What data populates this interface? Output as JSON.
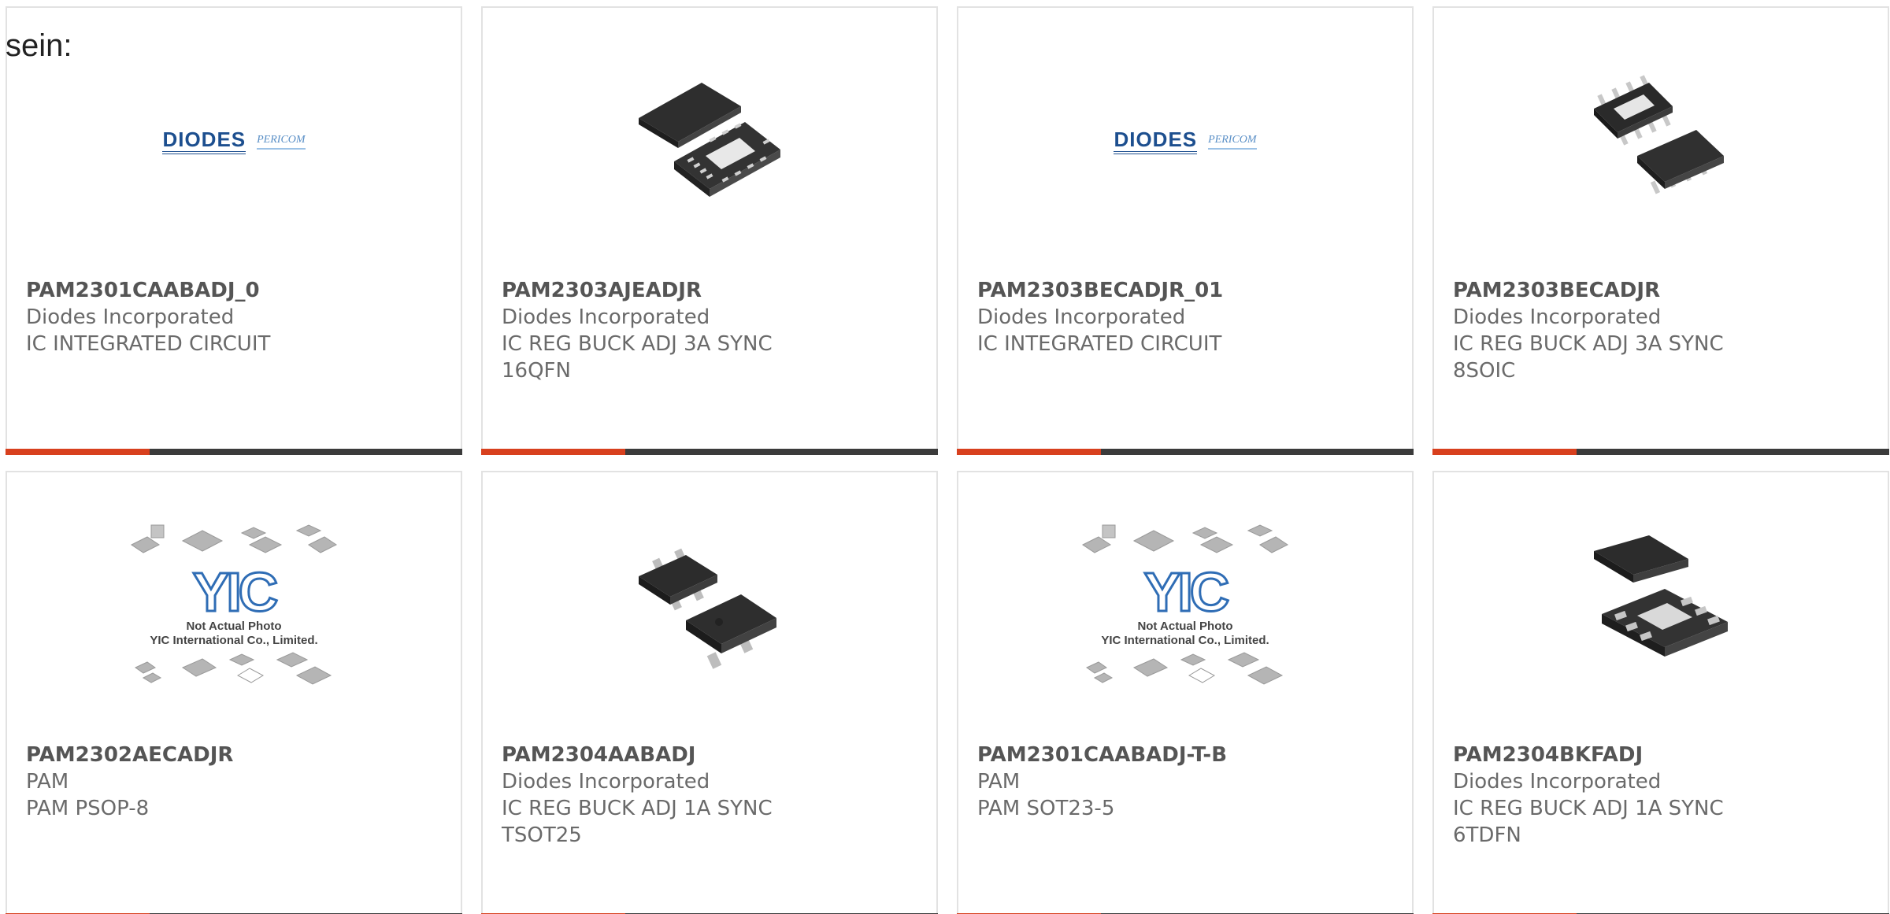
{
  "intro_text": "sein:",
  "products": [
    {
      "part_number": "PAM2301CAABADJ_0",
      "manufacturer": "Diodes Incorporated",
      "description": "IC INTEGRATED CIRCUIT",
      "image": "diodes-pericom-logo",
      "logo_text": "DIODES",
      "logo_sub": "PERICOM"
    },
    {
      "part_number": "PAM2303AJEADJR",
      "manufacturer": "Diodes Incorporated",
      "description": "IC REG BUCK ADJ 3A SYNC 16QFN",
      "image": "qfn16-chip-photo"
    },
    {
      "part_number": "PAM2303BECADJR_01",
      "manufacturer": "Diodes Incorporated",
      "description": "IC INTEGRATED CIRCUIT",
      "image": "diodes-pericom-logo",
      "logo_text": "DIODES",
      "logo_sub": "PERICOM"
    },
    {
      "part_number": "PAM2303BECADJR",
      "manufacturer": "Diodes Incorporated",
      "description": "IC REG BUCK ADJ 3A SYNC 8SOIC",
      "image": "soic8-chip-photo"
    },
    {
      "part_number": "PAM2302AECADJR",
      "manufacturer": "PAM",
      "description": "PAM PSOP-8",
      "image": "yic-placeholder",
      "placeholder_line1": "Not Actual Photo",
      "placeholder_line2": "YIC International Co., Limited."
    },
    {
      "part_number": "PAM2304AABADJ",
      "manufacturer": "Diodes Incorporated",
      "description": "IC REG BUCK ADJ 1A SYNC TSOT25",
      "image": "tsot25-chip-photo"
    },
    {
      "part_number": "PAM2301CAABADJ-T-B",
      "manufacturer": "PAM",
      "description": "PAM SOT23-5",
      "image": "yic-placeholder",
      "placeholder_line1": "Not Actual Photo",
      "placeholder_line2": "YIC International Co., Limited."
    },
    {
      "part_number": "PAM2304BKFADJ",
      "manufacturer": "Diodes Incorporated",
      "description": "IC REG BUCK ADJ 1A SYNC 6TDFN",
      "image": "tdfn6-chip-photo"
    }
  ],
  "colors": {
    "accent": "#d8401e",
    "bar": "#3b3b3b",
    "border": "#e2e2e2",
    "text": "#6a6a6a"
  }
}
